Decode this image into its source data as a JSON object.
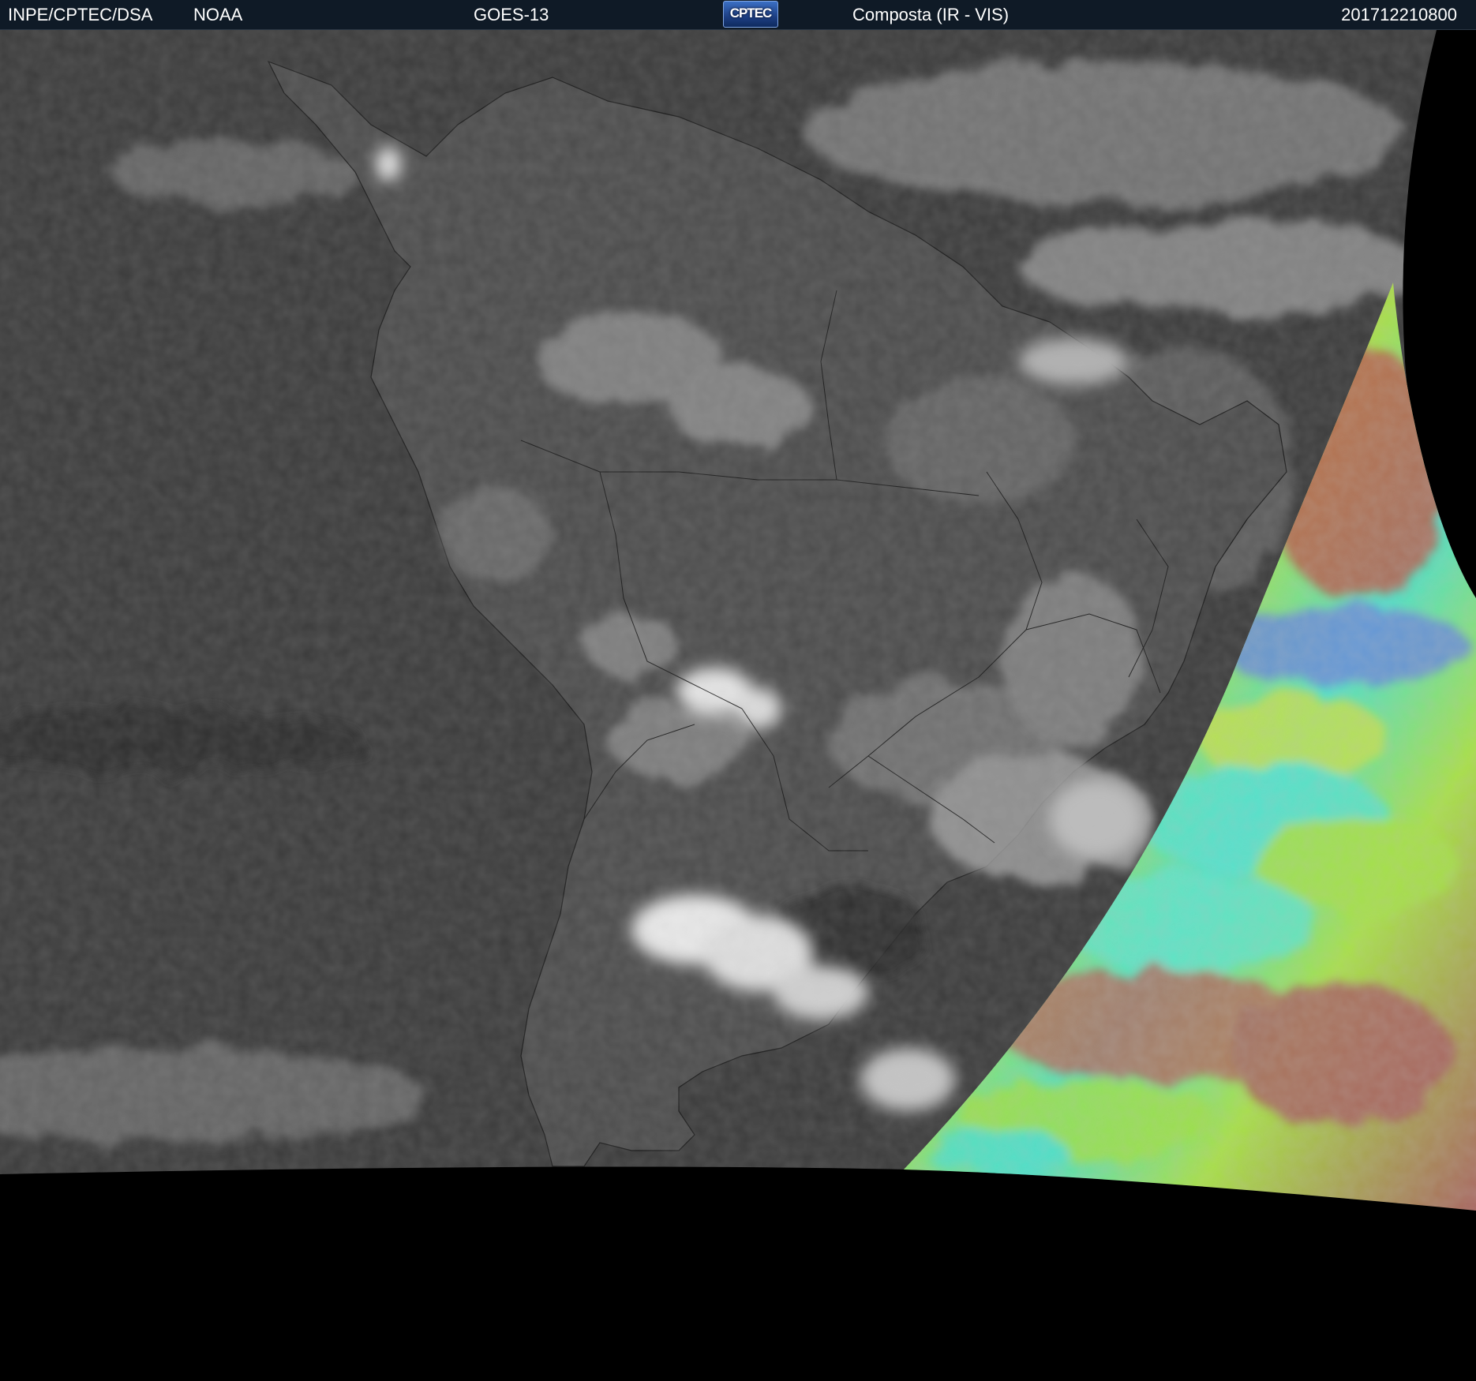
{
  "header": {
    "org": "INPE/CPTEC/DSA",
    "agency": "NOAA",
    "satellite": "GOES-13",
    "logo_text": "CPTEC",
    "product": "Composta (IR - VIS)",
    "timestamp": "201712210800"
  },
  "colors": {
    "header_bg": "#0f1a26",
    "space": "#000000",
    "ocean_ir": "#3c3c3c",
    "land_ir": "#4a4a4a",
    "cloud": "#d8d8d8",
    "vis_red": "#b05a50",
    "vis_green": "#a8e048",
    "vis_cyan": "#4fe0c8"
  },
  "image": {
    "description_icon": "satellite-composite-image"
  }
}
